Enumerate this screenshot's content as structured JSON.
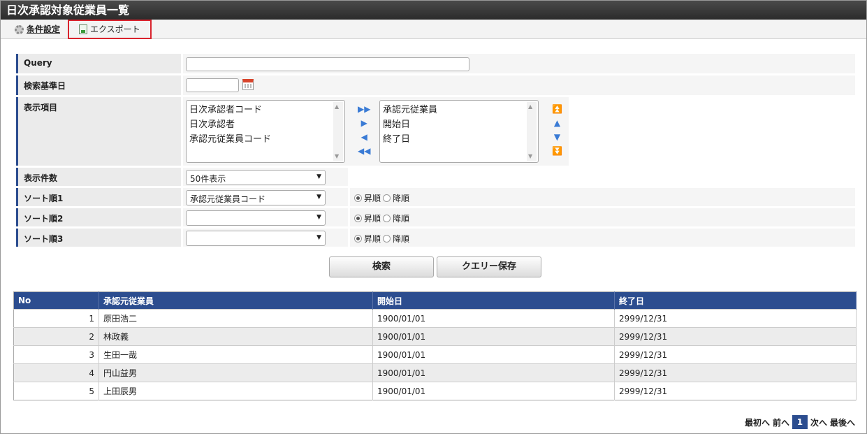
{
  "title": "日次承認対象従業員一覧",
  "tabs": {
    "settings": "条件設定",
    "export": "エクスポート"
  },
  "form": {
    "query_label": "Query",
    "query_value": "",
    "date_label": "検索基準日",
    "date_value": "",
    "columns_label": "表示項目",
    "available": [
      "日次承認者コード",
      "日次承認者",
      "承認元従業員コード"
    ],
    "selected": [
      "承認元従業員",
      "開始日",
      "終了日"
    ],
    "count_label": "表示件数",
    "count_value": "50件表示",
    "sort1_label": "ソート順1",
    "sort1_value": "承認元従業員コード",
    "sort2_label": "ソート順2",
    "sort2_value": "",
    "sort3_label": "ソート順3",
    "sort3_value": "",
    "asc": "昇順",
    "desc": "降順"
  },
  "buttons": {
    "search": "検索",
    "save_query": "クエリー保存"
  },
  "table": {
    "headers": [
      "No",
      "承認元従業員",
      "開始日",
      "終了日"
    ],
    "rows": [
      [
        "1",
        "原田浩二",
        "1900/01/01",
        "2999/12/31"
      ],
      [
        "2",
        "林政義",
        "1900/01/01",
        "2999/12/31"
      ],
      [
        "3",
        "生田一哉",
        "1900/01/01",
        "2999/12/31"
      ],
      [
        "4",
        "円山益男",
        "1900/01/01",
        "2999/12/31"
      ],
      [
        "5",
        "上田辰男",
        "1900/01/01",
        "2999/12/31"
      ]
    ]
  },
  "pager": {
    "first": "最初へ",
    "prev": "前へ",
    "current": "1",
    "next": "次へ",
    "last": "最後へ"
  }
}
